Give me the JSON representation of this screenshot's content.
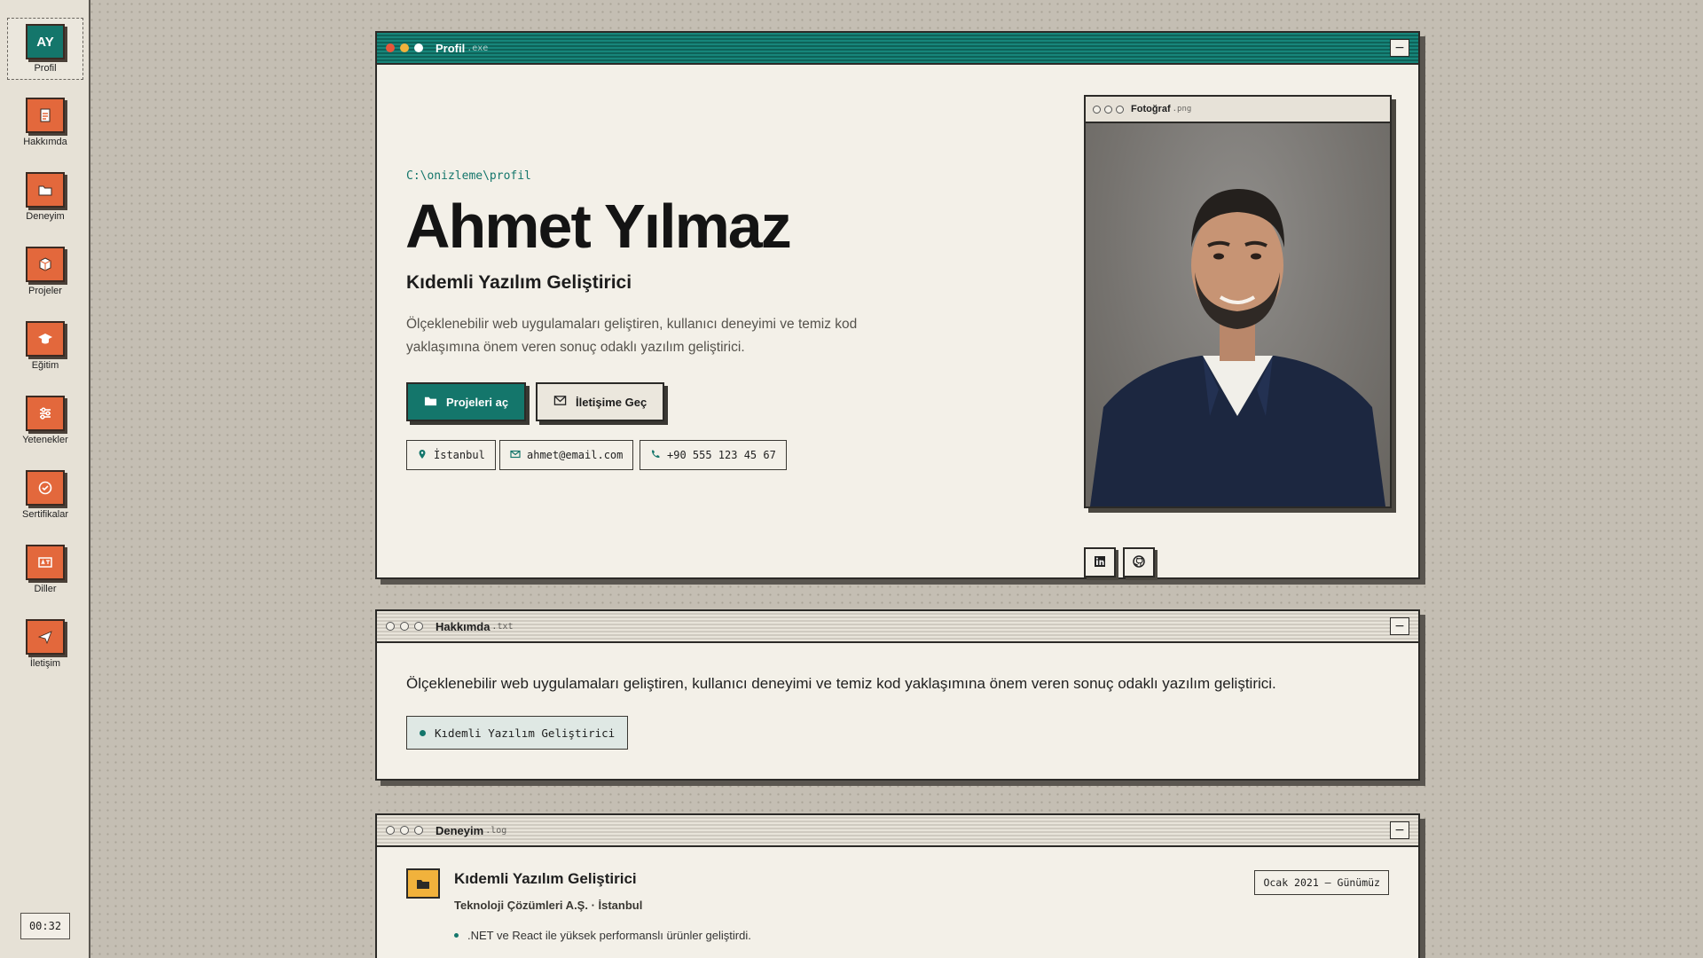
{
  "dock": {
    "avatar_initials": "AY",
    "items": [
      {
        "label": "Profil",
        "icon": "avatar-initials"
      },
      {
        "label": "Hakkımda",
        "icon": "document-icon"
      },
      {
        "label": "Deneyim",
        "icon": "folder-open-icon"
      },
      {
        "label": "Projeler",
        "icon": "package-icon"
      },
      {
        "label": "Eğitim",
        "icon": "graduation-cap-icon"
      },
      {
        "label": "Yetenekler",
        "icon": "sliders-icon"
      },
      {
        "label": "Sertifikalar",
        "icon": "check-circle-icon"
      },
      {
        "label": "Diller",
        "icon": "language-icon"
      },
      {
        "label": "İletişim",
        "icon": "send-icon"
      }
    ],
    "clock": "00:32"
  },
  "profile_window": {
    "title": "Profil",
    "ext": ".exe",
    "path": "C:\\onizleme\\profil",
    "name": "Ahmet Yılmaz",
    "role": "Kıdemli Yazılım Geliştirici",
    "description": "Ölçeklenebilir web uygulamaları geliştiren, kullanıcı deneyimi ve temiz kod yaklaşımına önem veren sonuç odaklı yazılım geliştirici.",
    "primary_button": "Projeleri aç",
    "secondary_button": "İletişime Geç",
    "chips": {
      "location": "İstanbul",
      "email": "ahmet@email.com",
      "phone": "+90 555 123 45 67"
    },
    "photo_window": {
      "title": "Fotoğraf",
      "ext": ".png"
    },
    "social": [
      "linkedin-icon",
      "github-icon"
    ]
  },
  "about_window": {
    "title": "Hakkımda",
    "ext": ".txt",
    "text": "Ölçeklenebilir web uygulamaları geliştiren, kullanıcı deneyimi ve temiz kod yaklaşımına önem veren sonuç odaklı yazılım geliştirici.",
    "tag": "Kıdemli Yazılım Geliştirici"
  },
  "experience_window": {
    "title": "Deneyim",
    "ext": ".log",
    "job_title": "Kıdemli Yazılım Geliştirici",
    "company": "Teknoloji Çözümleri A.Ş. · İstanbul",
    "date": "Ocak 2021 — Günümüz",
    "bullets": [
      ".NET ve React ile yüksek performanslı ürünler geliştirdi."
    ]
  },
  "colors": {
    "accent_teal": "#14766b",
    "accent_orange": "#e3683c",
    "accent_yellow": "#f1b23c",
    "background": "#c4beb3",
    "window_bg": "#f3f0e8"
  }
}
